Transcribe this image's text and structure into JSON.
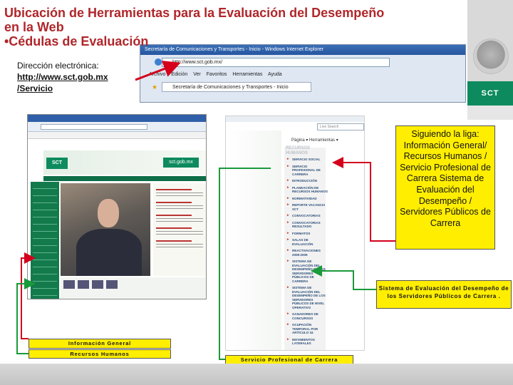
{
  "slide": {
    "title_line1": "Ubicación de Herramientas para la Evaluación del Desempeño",
    "title_line2": "en la Web",
    "title_line3": "•Cédulas de Evaluación"
  },
  "logo": {
    "badge": "SCT"
  },
  "address": {
    "label": "Dirección electrónica:",
    "url": "http://www.sct.gob.mx /Servicio"
  },
  "browser_top": {
    "window_title": "Secretaría de Comunicaciones y Transportes - Inicio - Windows Internet Explorer",
    "address_value": "http://www.sct.gob.mx/",
    "menu": "Archivo Edición Ver Favoritos Herramientas Ayuda",
    "tab_label": "Secretaría de Comunicaciones y Transportes - Inicio"
  },
  "site": {
    "logo_text": "SCT",
    "domain_text": "sct.gob.mx"
  },
  "menu_shot": {
    "search_placeholder": "Live Search",
    "tools": "Página ▾  Herramientas ▾",
    "heading": "RECURSOS HUMANOS",
    "items": [
      "SERVICIO SOCIAL",
      "SERVICIO PROFESIONAL DE CARRERA",
      "INTRODUCCIÓN",
      "PLANEACIÓN DE RECURSOS HUMANOS",
      "NORMATIVIDAD",
      "REPORTE VACANCIA SCT",
      "CONVOCATORIAS",
      "CONVOCATORIAS RESULTADO",
      "FORMATOS",
      "SALAS DE EVALUACIÓN",
      "REACTIVACIONES 2008-2009",
      "SISTEMA DE EVALUACIÓN DEL DESEMPEÑO DE LOS SERVIDORES PÚBLICOS DE CARRERA",
      "SISTEMA DE EVALUACIÓN DEL DESEMPEÑO DE LOS SERVIDORES PÚBLICOS DE NIVEL OPERATIVO",
      "GANADORES DE CONCURSOS",
      "OCUPACIÓN TEMPORAL POR ARTÍCULO 34",
      "MOVIMIENTOS LATERALES"
    ]
  },
  "callouts": {
    "main": "Siguiendo la liga: Información General/ Recursos Humanos / Servicio Profesional de Carrera Sistema de Evaluación del Desempeño / Servidores Públicos de Carrera",
    "sistema": "Sistema de Evaluación del Desempeño de los Servidores Públicos de Carrera .",
    "informacion": "Información General",
    "recursos": "Recursos Humanos",
    "servicio": "Servicio Profesional de Carrera"
  },
  "colors": {
    "title": "#b0262a",
    "callout": "#ffee00",
    "arrow_red": "#d4001c",
    "arrow_green": "#1a9a3a",
    "sct_green": "#0d8b5e"
  }
}
